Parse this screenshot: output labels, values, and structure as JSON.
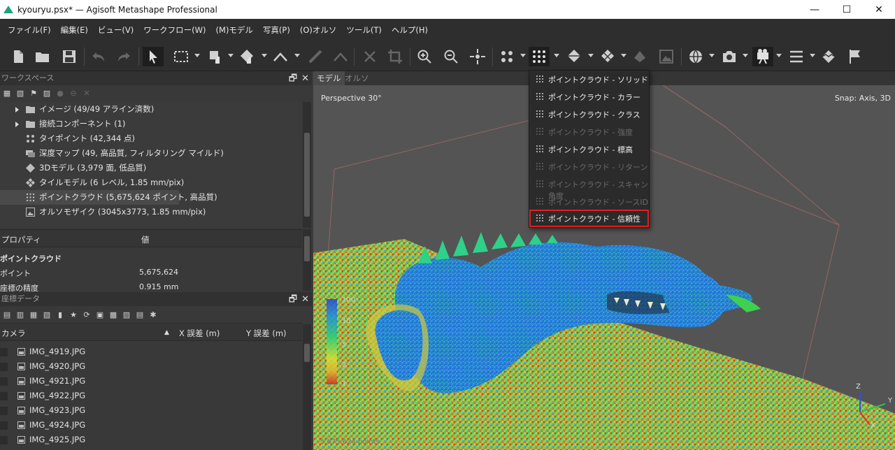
{
  "window": {
    "title": "kyouryu.psx* — Agisoft Metashape Professional",
    "controls": [
      "—",
      "☐",
      "✕"
    ]
  },
  "menu": [
    "ファイル(F)",
    "編集(E)",
    "ビュー(V)",
    "ワークフロー(W)",
    "(M)モデル",
    "写真(P)",
    "(O)オルソ",
    "ツール(T)",
    "ヘルプ(H)"
  ],
  "workspace": {
    "title": "ワークスペース",
    "items": [
      {
        "label": "イメージ (49/49 アライン済数)",
        "icon": "folder-icon",
        "expandable": true
      },
      {
        "label": "接続コンポーネント (1)",
        "icon": "folder-icon",
        "expandable": true
      },
      {
        "label": "タイポイント (42,344 点)",
        "icon": "tie-points-icon"
      },
      {
        "label": "深度マップ (49, 高品質, フィルタリング マイルド)",
        "icon": "depth-maps-icon"
      },
      {
        "label": "3Dモデル (3,979 面, 低品質)",
        "icon": "model-icon"
      },
      {
        "label": "タイルモデル (6 レベル, 1.85 mm/pix)",
        "icon": "tiled-model-icon"
      },
      {
        "label": "ポイントクラウド (5,675,624 ポイント, 高品質)",
        "icon": "point-cloud-icon",
        "selected": true
      },
      {
        "label": "オルソモザイク (3045x3773, 1.85 mm/pix)",
        "icon": "orthomosaic-icon"
      }
    ]
  },
  "properties": {
    "col_property": "プロパティ",
    "col_value": "値",
    "group": "ポイントクラウド",
    "rows": [
      {
        "name": "ポイント",
        "value": "5,675,624"
      },
      {
        "name": "座標の精度",
        "value": "0.915 mm"
      }
    ]
  },
  "reference": {
    "title": "座標データ",
    "col_camera": "カメラ",
    "col_x_error": "X 誤差 (m)",
    "col_y_error": "Y 誤差 (m)",
    "sort_indicator": "▲",
    "cameras": [
      "IMG_4919.JPG",
      "IMG_4920.JPG",
      "IMG_4921.JPG",
      "IMG_4922.JPG",
      "IMG_4923.JPG",
      "IMG_4924.JPG",
      "IMG_4925.JPG"
    ]
  },
  "viewport": {
    "tabs": [
      "モデル",
      "オルソ"
    ],
    "perspective": "Perspective 30°",
    "snap": "Snap: Axis, 3D",
    "point_count": "5,675,624 points",
    "colorbar_labels": [
      "100",
      "10",
      "5",
      "2",
      "1"
    ],
    "axis_labels": [
      "Z",
      "Y",
      "X"
    ]
  },
  "dropdown": {
    "items": [
      {
        "label": "ポイントクラウド - ソリッド",
        "enabled": true
      },
      {
        "label": "ポイントクラウド - カラー",
        "enabled": true
      },
      {
        "label": "ポイントクラウド - クラス",
        "enabled": true
      },
      {
        "label": "ポイントクラウド - 強度",
        "enabled": false
      },
      {
        "label": "ポイントクラウド - 標高",
        "enabled": true
      },
      {
        "label": "ポイントクラウド - リターン",
        "enabled": false
      },
      {
        "label": "ポイントクラウド - スキャン角度",
        "enabled": false
      },
      {
        "label": "ポイントクラウド - ソースID",
        "enabled": false
      },
      {
        "label": "ポイントクラウド - 信頼性",
        "enabled": true,
        "highlighted": true
      }
    ]
  },
  "colors": {
    "highlight_border": "#e02020",
    "accent_logo": "#1fa37a"
  }
}
